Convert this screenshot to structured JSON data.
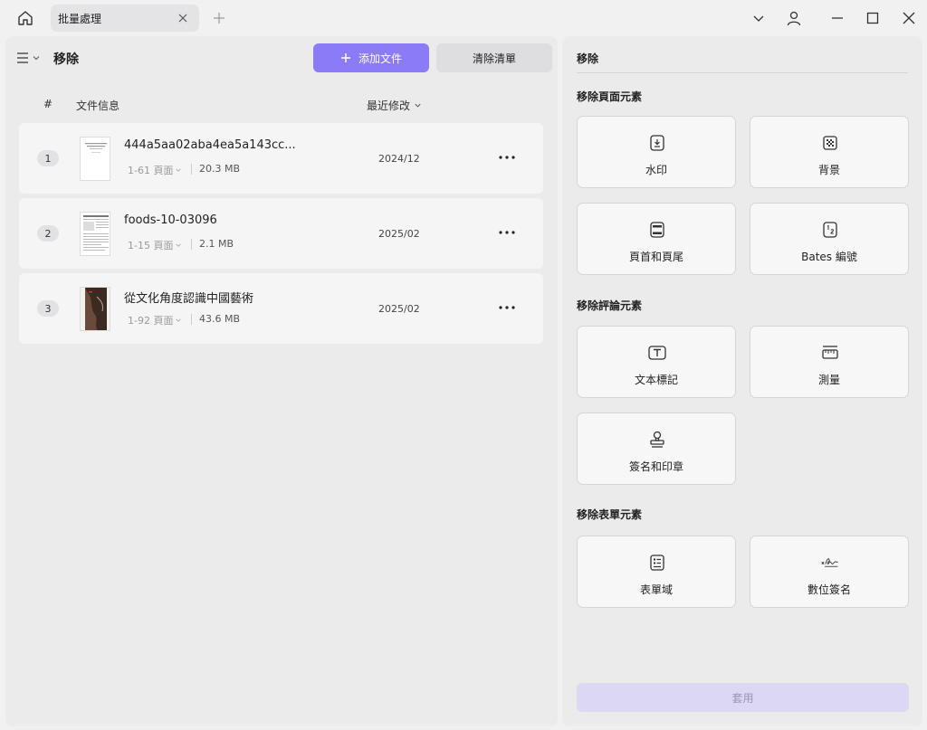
{
  "titlebar": {
    "tab_title": "批量處理"
  },
  "left": {
    "title": "移除",
    "add_button": "添加文件",
    "clear_button": "清除清單",
    "columns": {
      "index": "#",
      "file_info": "文件信息",
      "modified": "最近修改"
    },
    "files": [
      {
        "num": "1",
        "name": "444a5aa02aba4ea5a143cc...",
        "pages": "1-61 頁面",
        "size": "20.3 MB",
        "date": "2024/12"
      },
      {
        "num": "2",
        "name": "foods-10-03096",
        "pages": "1-15 頁面",
        "size": "2.1 MB",
        "date": "2025/02"
      },
      {
        "num": "3",
        "name": "從文化角度認識中國藝術",
        "pages": "1-92 頁面",
        "size": "43.6 MB",
        "date": "2025/02"
      }
    ]
  },
  "right": {
    "title": "移除",
    "sections": [
      {
        "title": "移除頁面元素"
      },
      {
        "title": "移除評論元素"
      },
      {
        "title": "移除表單元素"
      }
    ],
    "cards": [
      {
        "label": "水印",
        "icon": "watermark-icon"
      },
      {
        "label": "背景",
        "icon": "background-icon"
      },
      {
        "label": "頁首和頁尾",
        "icon": "header-footer-icon"
      },
      {
        "label": "Bates 編號",
        "icon": "bates-numbering-icon"
      },
      {
        "label": "文本標記",
        "icon": "text-markup-icon"
      },
      {
        "label": "測量",
        "icon": "measure-icon"
      },
      {
        "label": "簽名和印章",
        "icon": "stamp-icon"
      },
      {
        "label": "表單域",
        "icon": "form-field-icon"
      },
      {
        "label": "數位簽名",
        "icon": "digital-signature-icon"
      }
    ],
    "apply_button": "套用"
  },
  "colors": {
    "accent": "#8b7cf5",
    "apply_disabled": "#dcd8f3"
  }
}
